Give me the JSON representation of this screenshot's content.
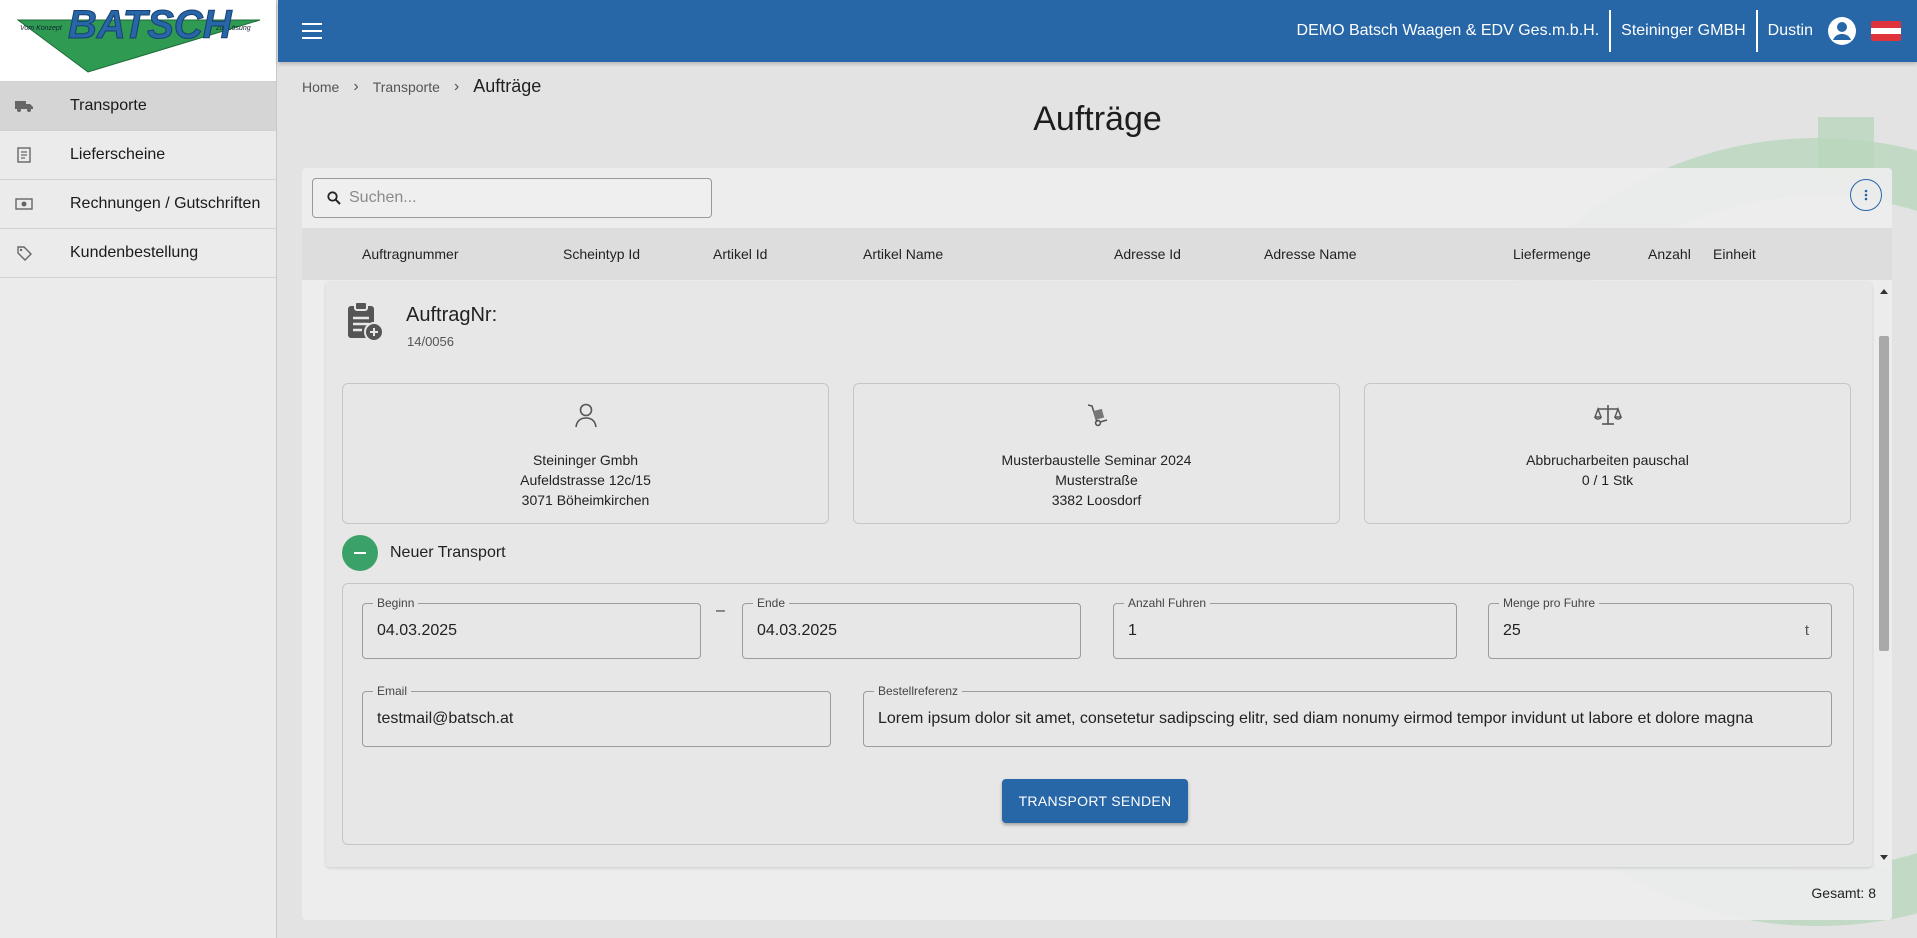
{
  "logo": {
    "brand": "BATSCH",
    "tagline_left": "Vom Konzept",
    "tagline_right": "zur Lösung"
  },
  "sidebar": {
    "items": [
      {
        "label": "Transporte",
        "icon": "truck-icon",
        "active": true
      },
      {
        "label": "Lieferscheine",
        "icon": "receipt-icon",
        "active": false
      },
      {
        "label": "Rechnungen / Gutschriften",
        "icon": "money-icon",
        "active": false
      },
      {
        "label": "Kundenbestellung",
        "icon": "tag-icon",
        "active": false
      }
    ]
  },
  "topbar": {
    "company": "DEMO Batsch Waagen & EDV Ges.m.b.H.",
    "client": "Steininger GMBH",
    "user": "Dustin",
    "language_flag": "austria-flag-icon"
  },
  "breadcrumb": {
    "items": [
      "Home",
      "Transporte"
    ],
    "current": "Aufträge"
  },
  "page": {
    "title": "Aufträge"
  },
  "search": {
    "placeholder": "Suchen..."
  },
  "table": {
    "columns": [
      "Auftragnummer",
      "Scheintyp Id",
      "Artikel Id",
      "Artikel Name",
      "Adresse Id",
      "Adresse Name",
      "Liefermenge",
      "Anzahl",
      "Einheit"
    ]
  },
  "order": {
    "title": "AuftragNr:",
    "number": "14/0056",
    "customer": {
      "name": "Steininger Gmbh",
      "street": "Aufeldstrasse 12c/15",
      "city": "3071 Böheimkirchen"
    },
    "site": {
      "name": "Musterbaustelle Seminar 2024",
      "street": "Musterstraße",
      "city": "3382 Loosdorf"
    },
    "article": {
      "name": "Abbrucharbeiten pauschal",
      "quantity": "0 / 1 Stk"
    }
  },
  "transport": {
    "toggle_label": "Neuer Transport",
    "begin": {
      "label": "Beginn",
      "value": "04.03.2025"
    },
    "range_separator": "–",
    "end": {
      "label": "Ende",
      "value": "04.03.2025"
    },
    "count": {
      "label": "Anzahl Fuhren",
      "value": "1"
    },
    "amount": {
      "label": "Menge pro Fuhre",
      "value": "25",
      "unit": "t"
    },
    "email": {
      "label": "Email",
      "value": "testmail@batsch.at"
    },
    "reference": {
      "label": "Bestellreferenz",
      "value": "Lorem ipsum dolor sit amet, consetetur sadipscing elitr, sed diam nonumy eirmod tempor invidunt ut labore et dolore magna"
    },
    "submit_label": "TRANSPORT SENDEN"
  },
  "footer": {
    "total": "Gesamt: 8"
  },
  "colors": {
    "primary": "#2766a7",
    "accent_green": "#3aa268",
    "background": "#e3e3e3"
  }
}
